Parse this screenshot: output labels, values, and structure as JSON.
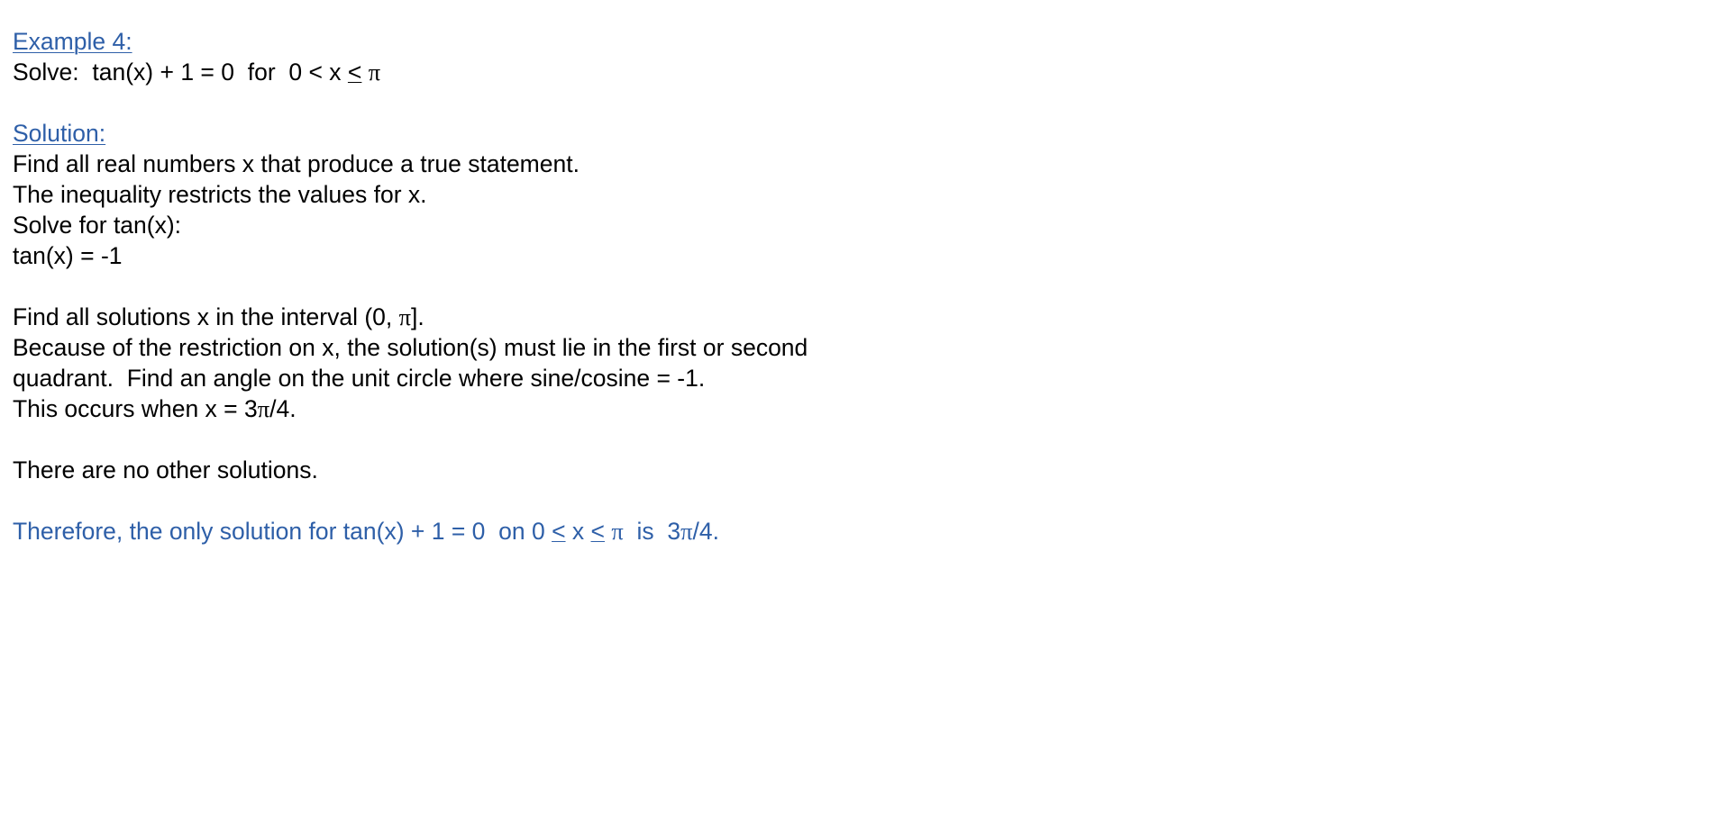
{
  "example": {
    "heading": "Example 4:",
    "problem": {
      "prefix": "Solve:  tan(x) + 1 = 0  for  0 < x ",
      "leq": "<",
      "space": " ",
      "pi": "π"
    }
  },
  "solution": {
    "heading": "Solution:",
    "intro_lines": [
      "Find all real numbers x that produce a true statement.",
      "The inequality restricts the values for x.",
      "Solve for tan(x):",
      "tan(x) = -1"
    ],
    "interval_line": {
      "prefix": "Find all solutions x in the interval (0, ",
      "pi": "π",
      "suffix": "]."
    },
    "reasoning_lines": [
      "Because of the restriction on x, the solution(s) must lie in the first or second",
      "quadrant.  Find an angle on the unit circle where sine/cosine = -1."
    ],
    "occurs_line": {
      "prefix": "This occurs when x = 3",
      "pi": "π",
      "suffix": "/4."
    },
    "no_other": "There are no other solutions.",
    "conclusion": {
      "prefix": "Therefore, the only solution for tan(x) + 1 = 0  on 0 ",
      "leq1": "<",
      "mid": " x ",
      "leq2": "<",
      "space": " ",
      "pi1": "π",
      "is_text": "  is  3",
      "pi2": "π",
      "suffix": "/4."
    }
  },
  "colors": {
    "heading": "#2e5fa8",
    "body": "#000000",
    "conclusion": "#2e5fa8"
  }
}
